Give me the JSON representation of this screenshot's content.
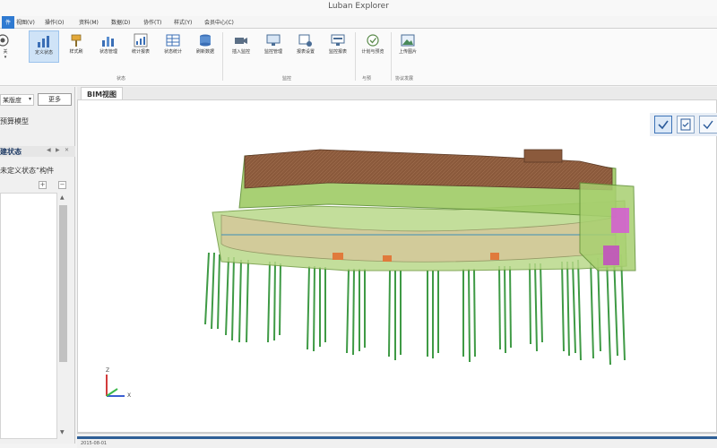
{
  "window": {
    "title": "Luban Explorer"
  },
  "menu": {
    "items": [
      {
        "label": "件"
      },
      {
        "label": "视图(V)"
      },
      {
        "label": "操作(O)"
      },
      {
        "label": "资料(M)"
      },
      {
        "label": "数据(D)"
      },
      {
        "label": "协作(T)"
      },
      {
        "label": "样式(Y)"
      },
      {
        "label": "会员中心(C)"
      }
    ]
  },
  "ribbon": {
    "partial_button": {
      "label": "关"
    },
    "buttons": [
      {
        "label": "定义状态"
      },
      {
        "label": "样式刷"
      },
      {
        "label": "状态管理"
      },
      {
        "label": "统计报表"
      },
      {
        "label": "状态统计"
      },
      {
        "label": "刷新数据"
      },
      {
        "label": "插入监控"
      },
      {
        "label": "监控管理"
      },
      {
        "label": "报表设置"
      },
      {
        "label": "监控报表"
      },
      {
        "label": "计划与预览"
      },
      {
        "label": "上传图片"
      }
    ],
    "groups": [
      {
        "label": "状态"
      },
      {
        "label": "监控"
      },
      {
        "label": "与预"
      },
      {
        "label": "协议发展"
      }
    ]
  },
  "left_panel": {
    "selector_value": "某版度",
    "more_button": "更多",
    "model_label": "预算模型",
    "section_title": "建状态",
    "status_text": "未定义状态”构件",
    "add_label": "+",
    "remove_label": "−"
  },
  "main": {
    "tab": "BIM视图",
    "axis": {
      "z": "Z",
      "x": "X"
    }
  },
  "status": {
    "text": "2015-08-01"
  },
  "colors": {
    "accent": "#2f7ad1",
    "roof": "#8b5a3c",
    "structure": "#8fcf5a",
    "piles": "#3f9a45",
    "highlight": "#d65ad6"
  }
}
